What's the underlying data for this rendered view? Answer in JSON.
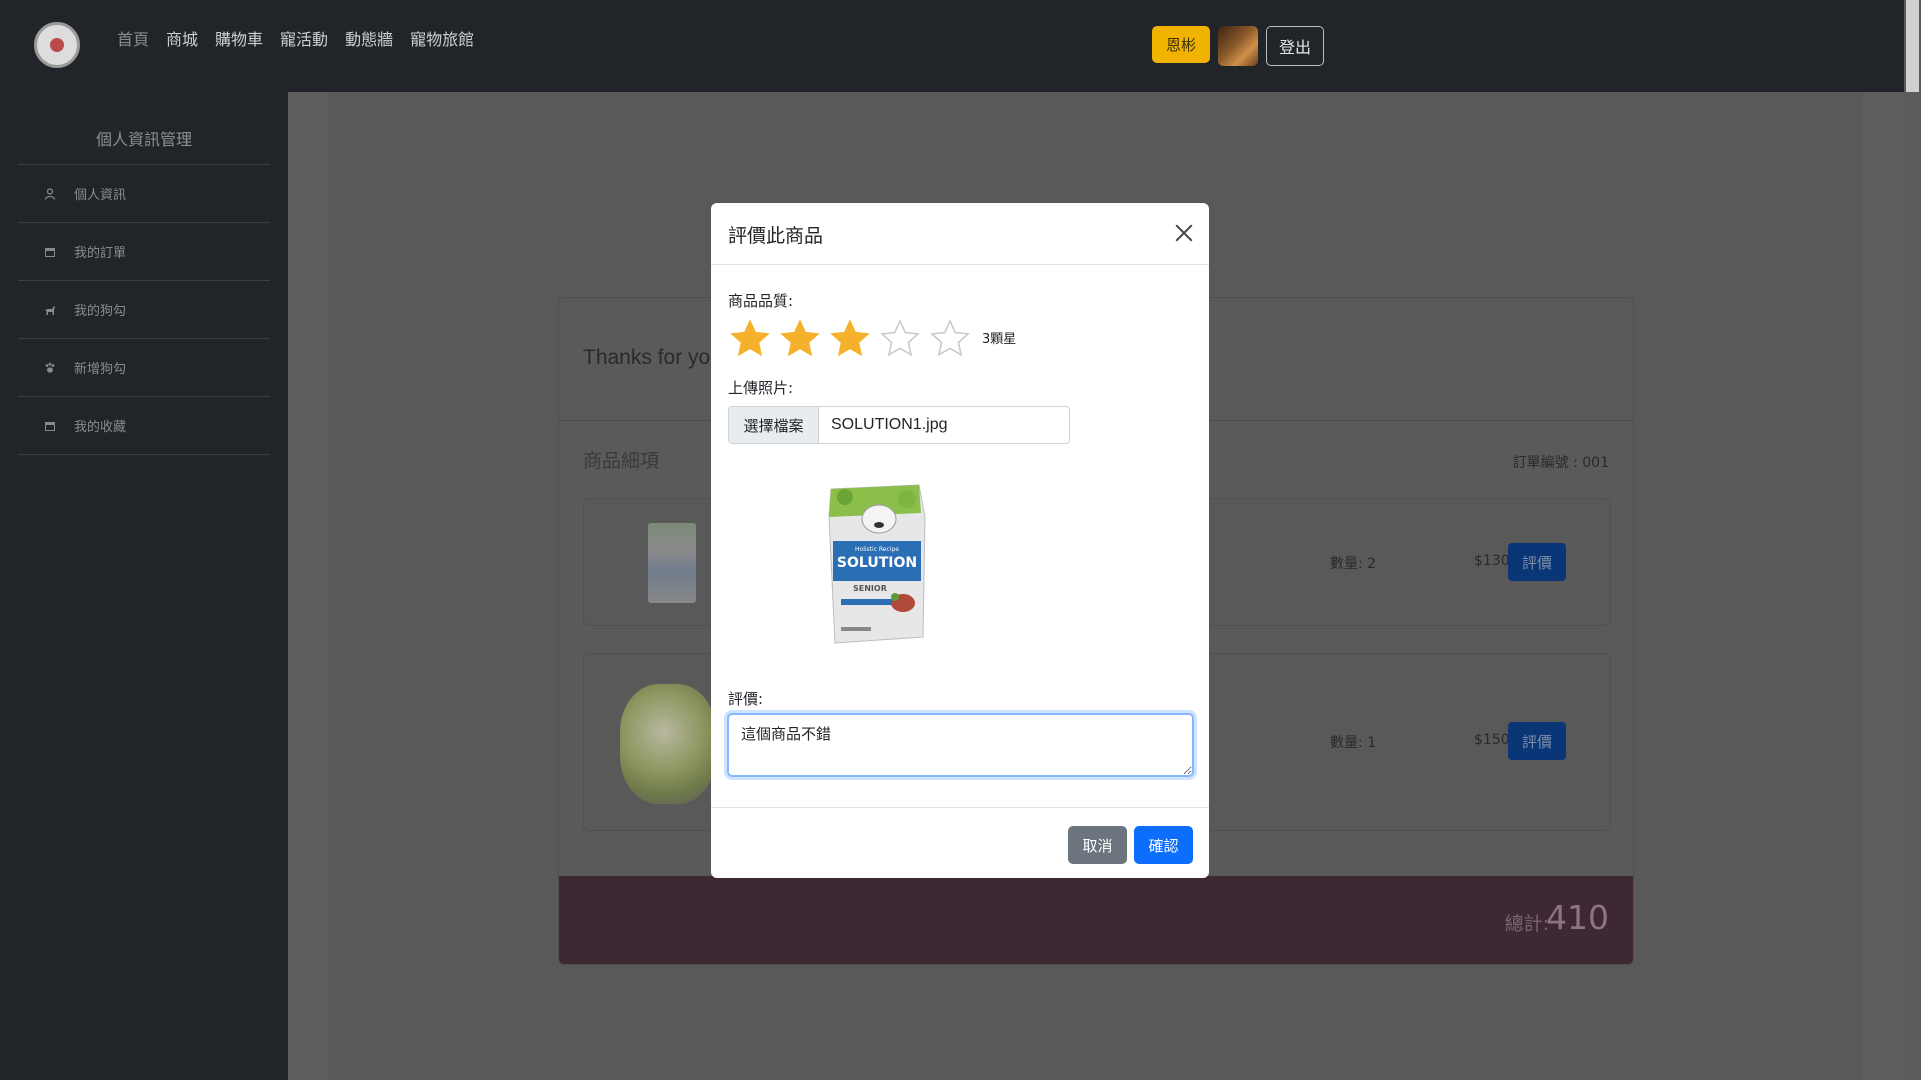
{
  "nav": {
    "links": [
      "首頁",
      "商城",
      "購物車",
      "寵活動",
      "動態牆",
      "寵物旅館"
    ],
    "user_label": "恩彬",
    "logout_label": "登出"
  },
  "sidebar": {
    "title": "個人資訊管理",
    "items": [
      {
        "label": "個人資訊",
        "icon": "user-icon"
      },
      {
        "label": "我的訂單",
        "icon": "calendar-icon"
      },
      {
        "label": "我的狗勾",
        "icon": "dog-icon"
      },
      {
        "label": "新增狗勾",
        "icon": "paw-icon"
      },
      {
        "label": "我的收藏",
        "icon": "calendar-icon"
      }
    ]
  },
  "order": {
    "thanks_text": "Thanks for yo",
    "items_title": "商品細項",
    "order_number": "訂單編號 : 001",
    "items": [
      {
        "qty": "數量: 2",
        "price": "$130",
        "rate_label": "評價"
      },
      {
        "qty": "數量: 1",
        "price": "$150",
        "rate_label": "評價"
      }
    ],
    "total_label": "總計:",
    "total_value": "410"
  },
  "modal": {
    "title": "評價此商品",
    "quality_label": "商品品質:",
    "rating": 3,
    "max_rating": 5,
    "rating_text": "3顆星",
    "upload_label": "上傳照片:",
    "file_button": "選擇檔案",
    "file_name": "SOLUTION1.jpg",
    "preview_brand": "SOLUTION",
    "preview_tagline": "Holistic Recipe",
    "preview_variant": "SENIOR",
    "review_label": "評價:",
    "review_text": "這個商品不錯",
    "cancel_label": "取消",
    "confirm_label": "確認"
  },
  "colors": {
    "star_filled": "#f5b12b",
    "star_empty": "#c8c8c8",
    "primary": "#0d6efd",
    "secondary": "#6c757d",
    "user_badge": "#f2b300"
  }
}
